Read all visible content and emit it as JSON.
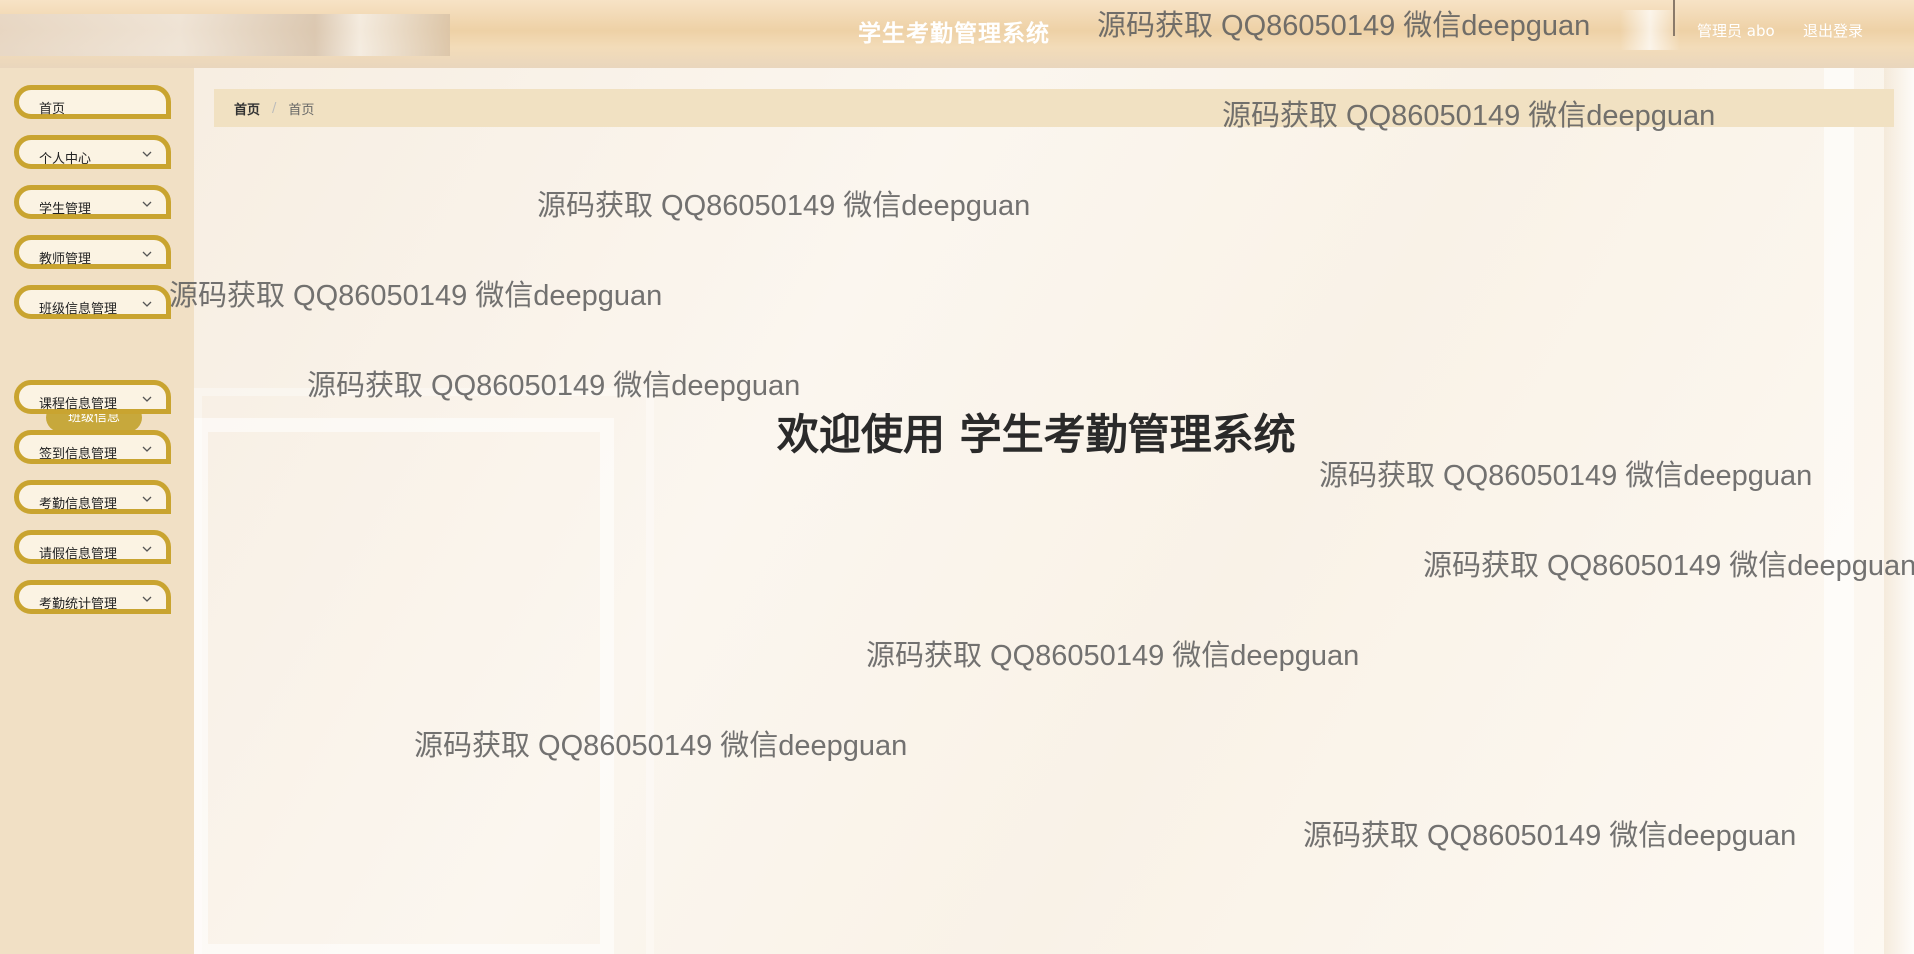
{
  "header": {
    "title": "学生考勤管理系统",
    "admin_label": "管理员 abo",
    "logout_label": "退出登录"
  },
  "sidebar": {
    "items": [
      {
        "label": "首页",
        "has_chevron": false
      },
      {
        "label": "个人中心",
        "has_chevron": true
      },
      {
        "label": "学生管理",
        "has_chevron": true
      },
      {
        "label": "教师管理",
        "has_chevron": true
      },
      {
        "label": "班级信息管理",
        "has_chevron": true
      },
      {
        "label": "课程信息管理",
        "has_chevron": true
      },
      {
        "label": "签到信息管理",
        "has_chevron": true
      },
      {
        "label": "考勤信息管理",
        "has_chevron": true
      },
      {
        "label": "请假信息管理",
        "has_chevron": true
      },
      {
        "label": "考勤统计管理",
        "has_chevron": true
      }
    ],
    "submenu": {
      "label": "班级信息"
    }
  },
  "breadcrumb": {
    "home": "首页",
    "separator": "/",
    "current": "首页"
  },
  "main": {
    "welcome": "欢迎使用 学生考勤管理系统"
  },
  "watermark": {
    "text": "源码获取 QQ86050149 微信deepguan"
  },
  "colors": {
    "accent_gold": "#c9a430",
    "sidebar_bg": "#f1e0c5",
    "breadcrumb_bg": "#f1e1c2"
  },
  "icons": {
    "menu_chevron": "chevron-down-icon"
  }
}
